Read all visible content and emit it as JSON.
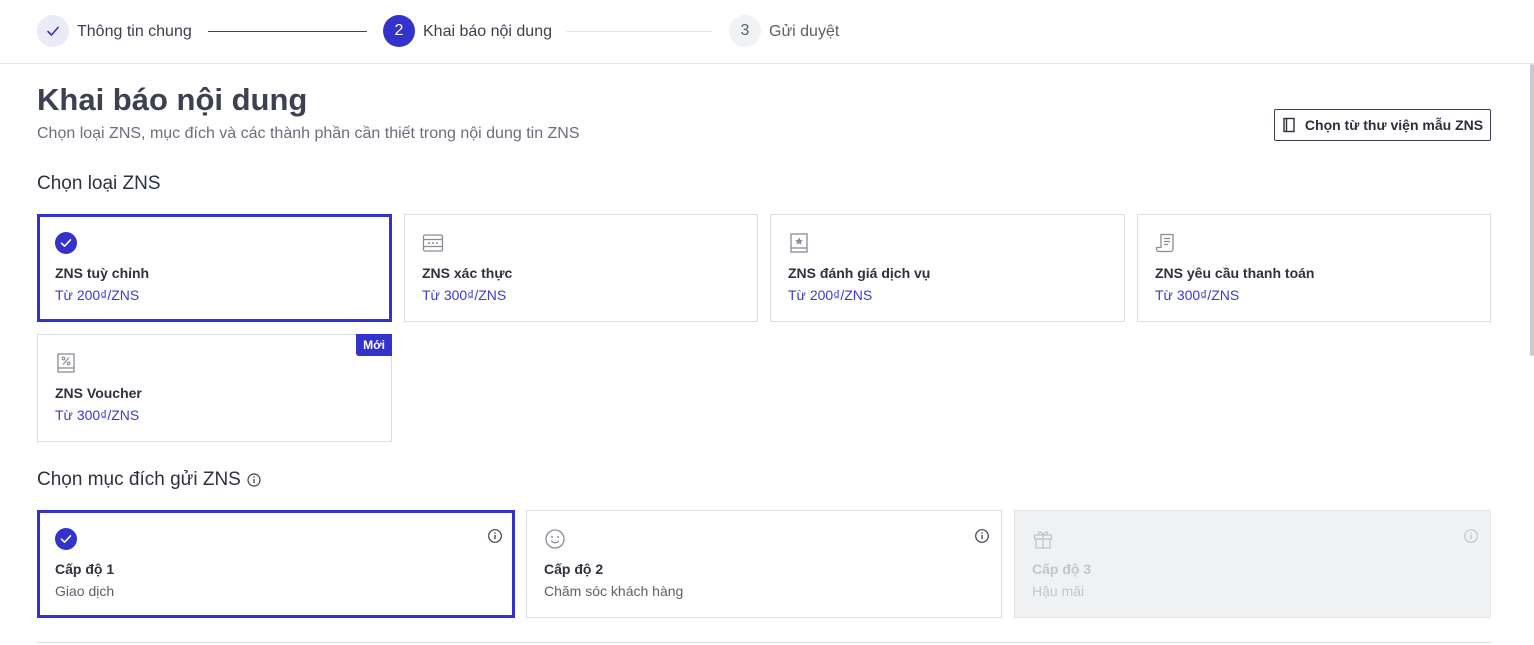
{
  "stepper": {
    "steps": [
      {
        "number": "1",
        "label": "Thông tin chung",
        "state": "done"
      },
      {
        "number": "2",
        "label": "Khai báo nội dung",
        "state": "active"
      },
      {
        "number": "3",
        "label": "Gửi duyệt",
        "state": "pending"
      }
    ]
  },
  "header": {
    "title": "Khai báo nội dung",
    "subtitle": "Chọn loại ZNS, mục đích và các thành phần cần thiết trong nội dung tin ZNS",
    "library_button": "Chọn từ thư viện mẫu ZNS"
  },
  "zns_type": {
    "section_title": "Chọn loại ZNS",
    "cards": [
      {
        "title": "ZNS tuỳ chỉnh",
        "price": "Từ 200₫/ZNS",
        "icon": "check-icon",
        "selected": true
      },
      {
        "title": "ZNS xác thực",
        "price": "Từ 300₫/ZNS",
        "icon": "password-icon",
        "selected": false
      },
      {
        "title": "ZNS đánh giá dịch vụ",
        "price": "Từ 200₫/ZNS",
        "icon": "star-rating-icon",
        "selected": false
      },
      {
        "title": "ZNS yêu cầu thanh toán",
        "price": "Từ 300₫/ZNS",
        "icon": "receipt-icon",
        "selected": false
      },
      {
        "title": "ZNS Voucher",
        "price": "Từ 300₫/ZNS",
        "icon": "voucher-icon",
        "selected": false,
        "badge": "Mới"
      }
    ]
  },
  "purpose": {
    "section_title": "Chọn mục đích gửi ZNS",
    "cards": [
      {
        "title": "Cấp độ 1",
        "subtitle": "Giao dịch",
        "icon": "check-icon",
        "selected": true,
        "disabled": false
      },
      {
        "title": "Cấp độ 2",
        "subtitle": "Chăm sóc khách hàng",
        "icon": "smile-icon",
        "selected": false,
        "disabled": false
      },
      {
        "title": "Cấp độ 3",
        "subtitle": "Hậu mãi",
        "icon": "gift-icon",
        "selected": false,
        "disabled": true
      }
    ]
  },
  "colors": {
    "accent": "#3333cc",
    "text": "#3c3f4d",
    "muted": "#6b6e7b",
    "border": "#dcdde2",
    "disabled_bg": "#f0f1f3"
  }
}
